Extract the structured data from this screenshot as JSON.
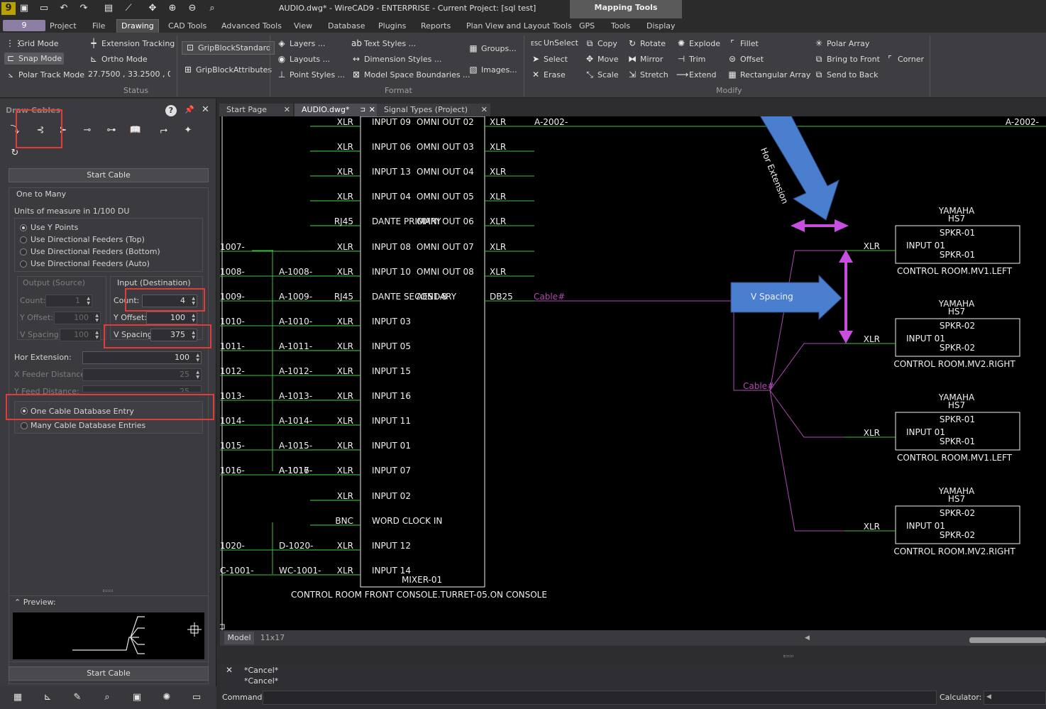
{
  "window": {
    "title": "AUDIO.dwg* - WireCAD9 - ENTERPRISE - Current Project: [sql test]",
    "context_tab": "Mapping Tools",
    "app_button": "9"
  },
  "menu": {
    "tabs": [
      "Project",
      "File",
      "Drawing",
      "CAD Tools",
      "Advanced Tools",
      "View",
      "Database",
      "Plugins",
      "Reports",
      "Plan View and Layout Tools",
      "GPS",
      "Tools",
      "Display"
    ],
    "active": "Drawing"
  },
  "ribbon": {
    "status": {
      "grid_mode": "Grid Mode",
      "snap_mode": "Snap Mode",
      "polar_track": "Polar Track Mode",
      "extension_tracking": "Extension Tracking",
      "ortho_mode": "Ortho Mode",
      "coords": "27.7500 , 33.2500 , 0.0",
      "group": "Status"
    },
    "grip": {
      "standard": "GripBlockStandard",
      "attributes": "GripBlockAttributes"
    },
    "format": {
      "layers": "Layers ...",
      "layouts": "Layouts ...",
      "point_styles": "Point Styles ...",
      "text_styles": "Text Styles ...",
      "dimension_styles": "Dimension Styles ...",
      "model_space": "Model Space Boundaries ...",
      "groups": "Groups...",
      "images": "Images...",
      "group": "Format"
    },
    "modify": {
      "unselect": "UnSelect",
      "select": "Select",
      "erase": "Erase",
      "copy": "Copy",
      "move": "Move",
      "scale": "Scale",
      "rotate": "Rotate",
      "mirror": "Mirror",
      "stretch": "Stretch",
      "explode": "Explode",
      "trim": "Trim",
      "extend": "Extend",
      "fillet": "Fillet",
      "offset": "Offset",
      "rect_array": "Rectangular Array",
      "polar_array": "Polar Array",
      "bring_front": "Bring to Front",
      "send_back": "Send to Back",
      "corner": "Corner",
      "group": "Modify"
    }
  },
  "panel": {
    "title": "Draw Cables",
    "start_cable": "Start Cable",
    "one_to_many": "One to Many",
    "units": "Units of measure in   1/100 DU",
    "options": [
      "Use Y Points",
      "Use Directional Feeders (Top)",
      "Use Directional Feeders (Bottom)",
      "Use Directional Feeders (Auto)"
    ],
    "output_label": "Output (Source)",
    "input_label": "Input (Destination)",
    "out_count_label": "Count:",
    "out_count": "1",
    "out_yoffset_label": "Y Offset:",
    "out_yoffset": "100",
    "out_vspacing_label": "V Spacing:",
    "out_vspacing": "100",
    "in_count_label": "Count:",
    "in_count": "4",
    "in_yoffset_label": "Y Offset:",
    "in_yoffset": "100",
    "in_vspacing_label": "V Spacing:",
    "in_vspacing": "375",
    "hor_ext_label": "Hor Extension:",
    "hor_ext": "100",
    "x_feeder_label": "X Feeder Distance:",
    "x_feeder": "25",
    "y_feed_label": "Y Feed Distance:",
    "y_feed": "25",
    "one_entry": "One Cable Database Entry",
    "many_entries": "Many Cable Database Entries",
    "preview": "Preview:"
  },
  "doc_tabs": [
    "Start Page",
    "AUDIO.dwg*",
    "Signal Types (Project)"
  ],
  "layout_tabs": [
    "Model",
    "11x17"
  ],
  "command": {
    "lines": [
      "*Cancel*",
      "*Cancel*"
    ],
    "label": "Command:",
    "calc": "Calculator:"
  },
  "drawing": {
    "left_rows": [
      {
        "conn": "XLR",
        "in": "INPUT 09",
        "out": "OMNI OUT 02",
        "oconn": "XLR"
      },
      {
        "conn": "XLR",
        "in": "INPUT 06",
        "out": "OMNI OUT 03",
        "oconn": "XLR"
      },
      {
        "conn": "XLR",
        "in": "INPUT 13",
        "out": "OMNI OUT 04",
        "oconn": "XLR"
      },
      {
        "conn": "XLR",
        "in": "INPUT 04",
        "out": "OMNI OUT 05",
        "oconn": "XLR"
      },
      {
        "conn": "RJ45",
        "in": "DANTE PRIMARY",
        "out": "OMNI OUT 06",
        "oconn": "XLR"
      },
      {
        "conn": "XLR",
        "in": "INPUT 08",
        "out": "OMNI OUT 07",
        "oconn": "XLR",
        "wire": "1007-"
      },
      {
        "conn": "XLR",
        "in": "INPUT 10",
        "out": "OMNI OUT 08",
        "oconn": "XLR",
        "wire": "1008-",
        "tag": "A-1008-"
      },
      {
        "conn": "RJ45",
        "in": "DANTE SECONDARY",
        "out": "AES1-8",
        "oconn": "DB25",
        "wire": "1009-",
        "tag": "A-1009-"
      },
      {
        "conn": "XLR",
        "in": "INPUT 03",
        "out": "",
        "oconn": "",
        "wire": "1010-",
        "tag": "A-1010-"
      },
      {
        "conn": "XLR",
        "in": "INPUT 05",
        "out": "",
        "oconn": "",
        "wire": "1011-",
        "tag": "A-1011-"
      },
      {
        "conn": "XLR",
        "in": "INPUT 15",
        "out": "",
        "oconn": "",
        "wire": "1012-",
        "tag": "A-1012-"
      },
      {
        "conn": "XLR",
        "in": "INPUT 16",
        "out": "",
        "oconn": "",
        "wire": "1013-",
        "tag": "A-1013-"
      },
      {
        "conn": "XLR",
        "in": "INPUT 11",
        "out": "",
        "oconn": "",
        "wire": "1014-",
        "tag": "A-1014-"
      },
      {
        "conn": "XLR",
        "in": "INPUT 01",
        "out": "",
        "oconn": "",
        "wire": "1015-",
        "tag": "A-1015-"
      },
      {
        "conn": "XLR",
        "in": "INPUT 07",
        "out": "",
        "oconn": "",
        "wire": "1016-",
        "tag": "A-1016-"
      },
      {
        "conn": "XLR",
        "in": "INPUT 02",
        "out": "",
        "oconn": ""
      },
      {
        "conn": "BNC",
        "in": "WORD CLOCK IN",
        "out": "",
        "oconn": ""
      },
      {
        "conn": "XLR",
        "in": "INPUT 12",
        "out": "",
        "oconn": "",
        "wire": "1020-",
        "tag": "D-1020-"
      },
      {
        "conn": "XLR",
        "in": "INPUT 14",
        "out": "",
        "oconn": "",
        "wire": "C-1001-",
        "tag": "WC-1001-"
      }
    ],
    "mixer_name": "MIXER-01",
    "mixer_location": "CONTROL  ROOM FRONT  CONSOLE.TURRET-05.ON CONSOLE",
    "overlap_tag": "A-1017-",
    "top_wire": "A-2002-",
    "cable_label": "Cable#",
    "speakers": [
      {
        "make": "YAMAHA",
        "model": "HS7",
        "name": "SPKR-01",
        "input": "INPUT 01",
        "conn": "XLR",
        "location": "CONTROL ROOM.MV1.LEFT"
      },
      {
        "make": "YAMAHA",
        "model": "HS7",
        "name": "SPKR-02",
        "input": "INPUT 01",
        "conn": "XLR",
        "location": "CONTROL ROOM.MV2.RIGHT"
      },
      {
        "make": "YAMAHA",
        "model": "HS7",
        "name": "SPKR-01",
        "input": "INPUT 01",
        "conn": "XLR",
        "location": "CONTROL ROOM.MV1.LEFT"
      },
      {
        "make": "YAMAHA",
        "model": "HS7",
        "name": "SPKR-02",
        "input": "INPUT 01",
        "conn": "XLR",
        "location": "CONTROL ROOM.MV2.RIGHT"
      }
    ],
    "callouts": {
      "hor": "Hor Extension",
      "vspacing": "V Spacing"
    },
    "colors": {
      "wire": "#3fbf3f",
      "cable": "#b04ab0",
      "callout": "#4a7fd0",
      "arrow": "#c84ee0",
      "highlight": "#e03c3c"
    }
  }
}
